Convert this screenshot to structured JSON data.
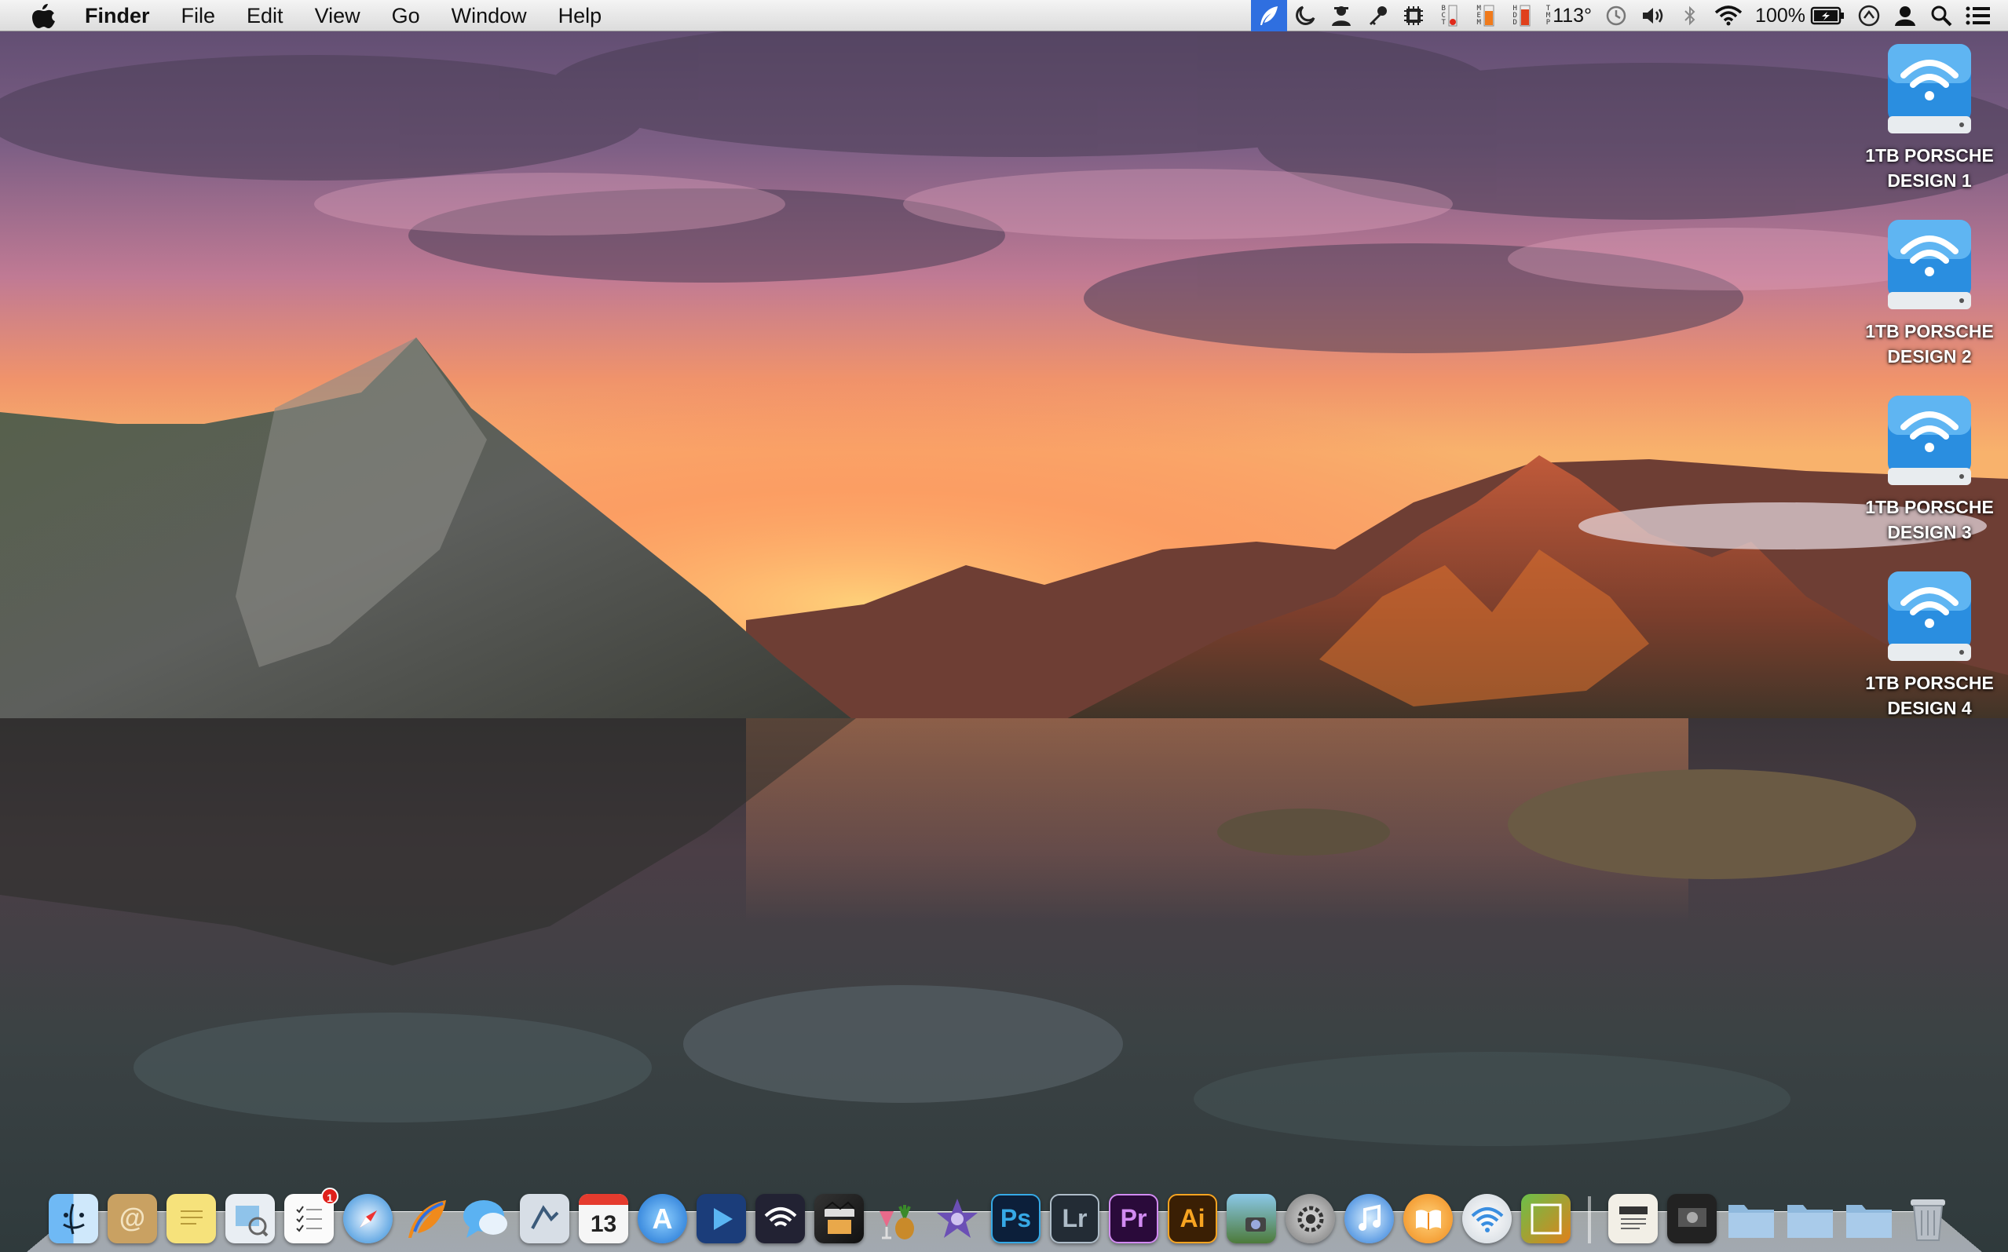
{
  "menubar": {
    "app_name": "Finder",
    "menus": [
      "File",
      "Edit",
      "View",
      "Go",
      "Window",
      "Help"
    ],
    "status": {
      "temperature": "113°",
      "battery": "100%",
      "tiny_labels_a": [
        "B",
        "C",
        "T"
      ],
      "tiny_labels_b": [
        "M",
        "E",
        "M"
      ],
      "tiny_labels_c": [
        "H",
        "D",
        "D"
      ],
      "tiny_labels_d": [
        "T",
        "M",
        "P"
      ]
    },
    "status_icons": [
      "feather-icon",
      "moon-icon",
      "user-silhouette-icon",
      "key-icon",
      "chip-icon",
      "cpu-meter-icon",
      "memory-meter-icon",
      "disk-meter-icon",
      "time-machine-icon",
      "volume-icon",
      "bluetooth-icon",
      "wifi-icon",
      "battery-charging-icon",
      "sync-icon",
      "user-icon",
      "search-icon",
      "list-icon"
    ]
  },
  "desktop": {
    "drives": [
      {
        "line1": "1TB PORSCHE",
        "line2": "DESIGN 1"
      },
      {
        "line1": "1TB PORSCHE",
        "line2": "DESIGN 2"
      },
      {
        "line1": "1TB PORSCHE",
        "line2": "DESIGN 3"
      },
      {
        "line1": "1TB PORSCHE",
        "line2": "DESIGN 4"
      }
    ]
  },
  "dock": {
    "calendar_day": "13",
    "mail_badge": "1",
    "apps": [
      "Finder",
      "Contacts",
      "Stickies",
      "Preview",
      "Reminders",
      "Safari",
      "Feather",
      "Messages",
      "Mail",
      "Calendar",
      "App Store",
      "QuickTime",
      "Wireless",
      "Final Cut",
      "Party",
      "iMovie",
      "Photoshop",
      "Lightroom",
      "Premiere",
      "Illustrator",
      "Image Capture",
      "System Preferences",
      "iTunes",
      "iBooks",
      "Wi-Fi",
      "Photo Booth",
      "Document",
      "Screenshot",
      "Folder 1",
      "Folder 2",
      "Folder 3",
      "Trash"
    ],
    "adobe": {
      "ps": "Ps",
      "lr": "Lr",
      "pr": "Pr",
      "ai": "Ai"
    }
  },
  "colors": {
    "highlight": "#2f6fe0",
    "drive_blue": "#2a8ee0",
    "ps": "#36a9e6",
    "lr": "#aebcc8",
    "pr": "#d28bf2",
    "ai": "#f7a421"
  }
}
